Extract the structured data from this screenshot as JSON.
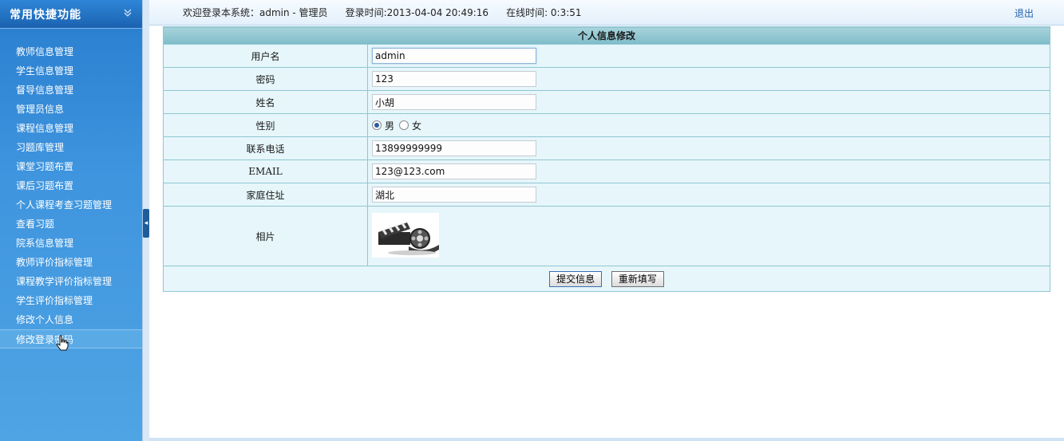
{
  "sidebar": {
    "title": "常用快捷功能",
    "items": [
      {
        "label": "教师信息管理"
      },
      {
        "label": "学生信息管理"
      },
      {
        "label": "督导信息管理"
      },
      {
        "label": "管理员信息"
      },
      {
        "label": "课程信息管理"
      },
      {
        "label": "习题库管理"
      },
      {
        "label": "课堂习题布置"
      },
      {
        "label": "课后习题布置"
      },
      {
        "label": "个人课程考查习题管理"
      },
      {
        "label": "查看习题"
      },
      {
        "label": "院系信息管理"
      },
      {
        "label": "教师评价指标管理"
      },
      {
        "label": "课程教学评价指标管理"
      },
      {
        "label": "学生评价指标管理"
      },
      {
        "label": "修改个人信息"
      },
      {
        "label": "修改登录密码"
      }
    ],
    "active_index": 15
  },
  "topbar": {
    "welcome": "欢迎登录本系统：admin - 管理员",
    "login_time": "登录时间:2013-04-04 20:49:16",
    "online_time": "在线时间: 0:3:51",
    "logout": "退出"
  },
  "form": {
    "title": "个人信息修改",
    "fields": {
      "username": {
        "label": "用户名",
        "value": "admin"
      },
      "password": {
        "label": "密码",
        "value": "123"
      },
      "name": {
        "label": "姓名",
        "value": "小胡"
      },
      "gender": {
        "label": "性别",
        "options": [
          "男",
          "女"
        ],
        "selected": "男"
      },
      "phone": {
        "label": "联系电话",
        "value": "13899999999"
      },
      "email": {
        "label": "EMAIL",
        "value": "123@123.com"
      },
      "address": {
        "label": "家庭住址",
        "value": "湖北"
      },
      "photo": {
        "label": "相片"
      }
    },
    "submit_label": "提交信息",
    "reset_label": "重新填写"
  },
  "icons": {
    "collapse": "chevron-double-down-icon",
    "photo": "film-clapper-icon",
    "cursor": "hand-pointer-icon"
  }
}
